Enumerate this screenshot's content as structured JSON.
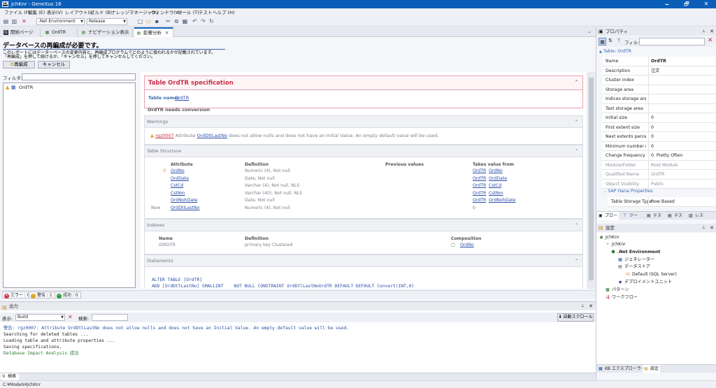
{
  "window": {
    "title": "JchKnr - GeneXus 16",
    "minimize": "🗕",
    "maximize": "🗗",
    "close": "✕"
  },
  "menu": [
    "ファイル (F)",
    "編集 (E)",
    "表示(V)",
    "レイアウト(L)",
    "ビルド (B)",
    "ナレッジマネージャ(K)",
    "ウィンドウ(W)",
    "ツール (T)",
    "テスト",
    "ヘルプ (H)"
  ],
  "toolbar": {
    "environment": ".Net Environment",
    "configuration": "Release"
  },
  "doc_tabs": [
    {
      "label": "開始ページ",
      "icon": "start-page-icon"
    },
    {
      "label": "OrdTR",
      "icon": "transaction-icon"
    },
    {
      "label": "ナビゲーション表示",
      "icon": "navigation-icon"
    },
    {
      "label": "影響分析",
      "icon": "impact-analysis-icon"
    }
  ],
  "impact": {
    "heading": "データベースの再編成が必要です。",
    "desc1": "このレポートにはデーターベースの変更内容と、再編成プログラムでどのように扱われるかが記載されています。",
    "desc2": "「再編成」を押して続けるか、「キャンセル」を押してキャンセルしてください。",
    "reorg_button": "再編成",
    "cancel_button": "キャンセル",
    "filter_label": "フィルタ:",
    "filter_value": "",
    "tree_item": "OrdTR"
  },
  "spec": {
    "title": "Table OrdTR specification",
    "table_name_label": "Table name:",
    "table_name": "OrdTR",
    "needs_conversion": "OrdTR needs conversion",
    "warnings_title": "Warnings",
    "warning_code": "rgz0007",
    "warning_pre": "Attribute",
    "warning_attr": "OrdDtlLastNo",
    "warning_text": "does not allow nulls and does not have an Initial Value. An empty default value will be used.",
    "structure_title": "Table Structure",
    "columns": [
      "Attribute",
      "Definition",
      "Previous values",
      "Takes value from"
    ],
    "rows": [
      {
        "flag": "",
        "attr": "OrdNo",
        "def": "Numeric (4), Not null",
        "prev": "",
        "from_t": "OrdTR",
        "from_a": "OrdNo"
      },
      {
        "flag": "",
        "attr": "OrdDate",
        "def": "Date, Not null",
        "prev": "",
        "from_t": "OrdTR",
        "from_a": "OrdDate"
      },
      {
        "flag": "",
        "attr": "CstCd",
        "def": "Varchar (4), Not null, NLS",
        "prev": "",
        "from_t": "OrdTR",
        "from_a": "CstCd"
      },
      {
        "flag": "",
        "attr": "CstNm",
        "def": "Varchar (40), Not null, NLS",
        "prev": "",
        "from_t": "OrdTR",
        "from_a": "CstNm"
      },
      {
        "flag": "",
        "attr": "OrdNohDate",
        "def": "Date, Not null",
        "prev": "",
        "from_t": "OrdTR",
        "from_a": "OrdNohDate"
      },
      {
        "flag": "New",
        "attr": "OrdDtlLastNo",
        "def": "Numeric (4), Not null",
        "prev": "",
        "from_t": "0",
        "from_a": ""
      }
    ],
    "indexes_title": "Indexes",
    "index_columns": [
      "Name",
      "Definition",
      "Composition"
    ],
    "index_row": {
      "name": "IORDTR",
      "def": "primary key Clustered",
      "comp": "OrdNo"
    },
    "statements_title": "Statements",
    "stmt1": "ALTER TABLE [OrdTR]",
    "stmt2": "ADD [OrdDtlLastNo] SMALLINT    NOT NULL CONSTRAINT OrdDtlLastNoOrdTR DEFAULT DEFAULT Convert(INT,0)"
  },
  "status_pills": {
    "errors": "エラー : 0",
    "warnings": "警告 : 1",
    "success": "成功 : 0"
  },
  "output": {
    "title": "出力",
    "show_label": "表示:",
    "show_value": "Build",
    "search_label": "検索:",
    "autoscroll": "自動スクロール",
    "lines": [
      {
        "text": "警告: rgz0007: Attribute OrdDtlLastNo does not allow nulls and does not have an Initial Value. An empty default value will be used.",
        "color": "#2a4ea8"
      },
      {
        "text": "Searching for deleted tables ...",
        "color": "#1e1e1e"
      },
      {
        "text": "Loading table and attribute properties ...",
        "color": "#1e1e1e"
      },
      {
        "text": "Saving specifications.",
        "color": "#1e1e1e"
      },
      {
        "text": "Database Impact Analysis 成功",
        "color": "#2a7a2a"
      }
    ]
  },
  "bottom_tab": "検索",
  "statusbar": "C:¥Models¥JchKnr",
  "properties": {
    "title": "プロパティ",
    "filter_label": "フィルタ",
    "category": "Table: OrdTR",
    "rows": [
      {
        "k": "Name",
        "v": "OrdTR",
        "dim": false,
        "bold": true
      },
      {
        "k": "Description",
        "v": "注文",
        "dim": false
      },
      {
        "k": "Cluster index",
        "v": "",
        "dim": false
      },
      {
        "k": "Storage area",
        "v": "",
        "dim": false
      },
      {
        "k": "Indices storage area",
        "v": "",
        "dim": false
      },
      {
        "k": "Text storage area",
        "v": "",
        "dim": false
      },
      {
        "k": "Initial size",
        "v": "0",
        "dim": false
      },
      {
        "k": "First extent size",
        "v": "0",
        "dim": false
      },
      {
        "k": "Next extents percent",
        "v": "0",
        "dim": false
      },
      {
        "k": "Minimum number of",
        "v": "0",
        "dim": false
      },
      {
        "k": "Change frequency",
        "v": "0. Pretty Often",
        "dim": false
      },
      {
        "k": "Module/Folder",
        "v": "Root Module",
        "dim": true
      },
      {
        "k": "Qualified Name",
        "v": "OrdTR",
        "dim": true
      },
      {
        "k": "Object Visibility",
        "v": "Public",
        "dim": true
      }
    ],
    "subcategory": "SAP Hana Properties",
    "sap_row": {
      "k": "Table Storage Type",
      "v": "Row Based"
    }
  },
  "panel_tabs": [
    "プロー",
    "ツー",
    "テス",
    "テス",
    "レス"
  ],
  "settings": {
    "title": "設定",
    "tree": [
      {
        "label": "JchKnr",
        "icon": "kb-icon",
        "x": 3,
        "bold": false
      },
      {
        "label": "JchKnr",
        "icon": "version-icon",
        "x": 12,
        "bold": false
      },
      {
        "label": ".Net Environment",
        "icon": "environment-icon",
        "x": 20,
        "bold": true
      },
      {
        "label": "ジェネレーター",
        "icon": "generator-icon",
        "x": 30,
        "bold": false
      },
      {
        "label": "データストア",
        "icon": "datastore-icon",
        "x": 30,
        "bold": false
      },
      {
        "label": "Default (SQL Server)",
        "icon": "database-icon",
        "x": 41,
        "bold": false
      },
      {
        "label": "デプロイメントユニット",
        "icon": "deploy-icon",
        "x": 30,
        "bold": false
      },
      {
        "label": "パターン",
        "icon": "pattern-icon",
        "x": 12,
        "bold": false
      },
      {
        "label": "ワークフロー",
        "icon": "workflow-icon",
        "x": 12,
        "bold": false
      }
    ]
  },
  "kb_tabs": [
    "KB エクスプローラー",
    "設定"
  ]
}
